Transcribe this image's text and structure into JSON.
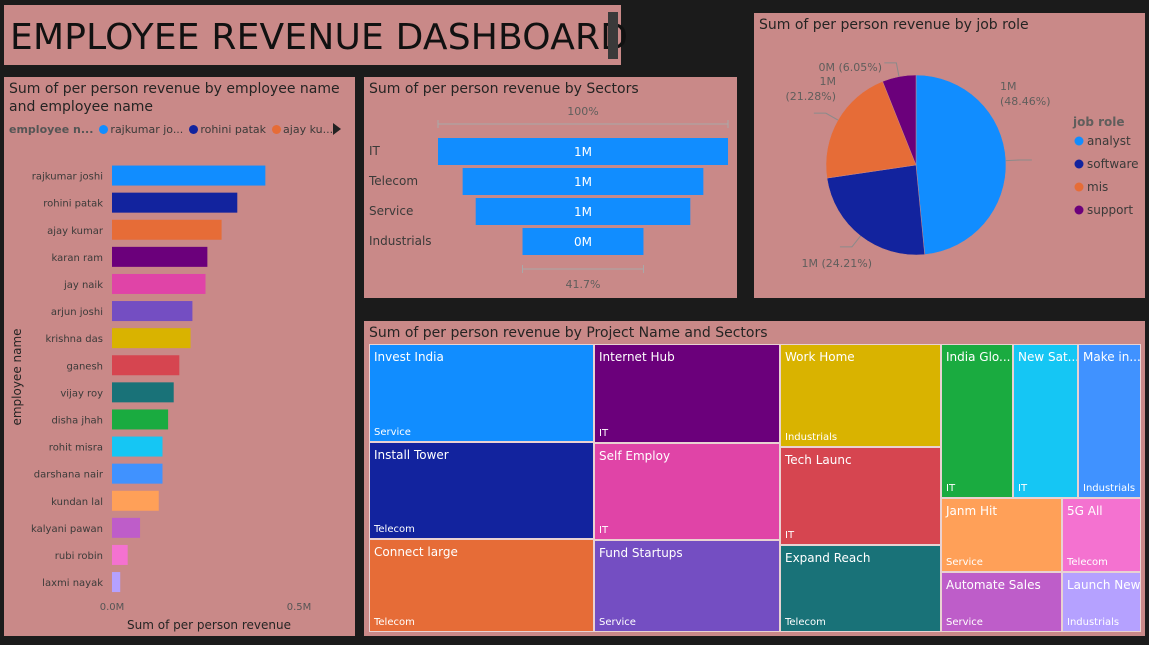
{
  "dashboard_title": "EMPLOYEE REVENUE DASHBOARD",
  "chart_data": [
    {
      "type": "bar",
      "orientation": "horizontal",
      "title": "Sum of per person revenue by employee name and employee name",
      "xlabel": "Sum of per person revenue",
      "ylabel": "employee name",
      "xlim": [
        0,
        0.5
      ],
      "x_ticks": [
        "0.0M",
        "0.5M"
      ],
      "legend": {
        "title": "employee n...",
        "entries": [
          "rajkumar jo...",
          "rohini patak",
          "ajay ku..."
        ]
      },
      "categories": [
        "rajkumar joshi",
        "rohini patak",
        "ajay kumar",
        "karan ram",
        "jay naik",
        "arjun joshi",
        "krishna das",
        "ganesh",
        "vijay roy",
        "disha jhah",
        "rohit misra",
        "darshana nair",
        "kundan lal",
        "kalyani pawan",
        "rubi robin",
        "laxmi nayak"
      ],
      "values": [
        0.41,
        0.335,
        0.293,
        0.255,
        0.25,
        0.215,
        0.21,
        0.18,
        0.165,
        0.15,
        0.135,
        0.135,
        0.125,
        0.075,
        0.042,
        0.022
      ],
      "colors": [
        "#118dff",
        "#12239e",
        "#e66c37",
        "#6b007b",
        "#e044a7",
        "#744ec2",
        "#d9b300",
        "#d64550",
        "#197278",
        "#1aab40",
        "#15c6f4",
        "#4092ff",
        "#ffa058",
        "#be5dc9",
        "#f472d0",
        "#b5a1ff"
      ]
    },
    {
      "type": "bar",
      "subtype": "funnel",
      "title": "Sum of per person revenue by Sectors",
      "categories": [
        "IT",
        "Telecom",
        "Service",
        "Industrials"
      ],
      "values": [
        1.0,
        0.83,
        0.74,
        0.417
      ],
      "value_labels": [
        "1M",
        "1M",
        "1M",
        "0M"
      ],
      "top_label": "100%",
      "bottom_label": "41.7%",
      "color": "#118dff"
    },
    {
      "type": "pie",
      "title": "Sum of per person revenue by job role",
      "legend": {
        "title": "job role",
        "placement": "right"
      },
      "categories": [
        "analyst",
        "software",
        "mis",
        "support"
      ],
      "values": [
        48.46,
        24.21,
        21.28,
        6.05
      ],
      "value_labels": [
        "1M",
        "1M (24.21%)",
        "1M",
        "0M (6.05%)"
      ],
      "percent_labels": [
        "(48.46%)",
        "",
        "(21.28%)",
        ""
      ],
      "colors": [
        "#118dff",
        "#12239e",
        "#e66c37",
        "#6b007b"
      ]
    },
    {
      "type": "treemap",
      "title": "Sum of per person revenue by Project Name and Sectors",
      "items": [
        {
          "name": "Invest India",
          "sector": "Service",
          "color": "#118dff"
        },
        {
          "name": "Install Tower",
          "sector": "Telecom",
          "color": "#12239e"
        },
        {
          "name": "Connect large",
          "sector": "Telecom",
          "color": "#e66c37"
        },
        {
          "name": "Internet Hub",
          "sector": "IT",
          "color": "#6b007b"
        },
        {
          "name": "Self Employ",
          "sector": "IT",
          "color": "#e044a7"
        },
        {
          "name": "Fund Startups",
          "sector": "Service",
          "color": "#744ec2"
        },
        {
          "name": "Work Home",
          "sector": "Industrials",
          "color": "#d9b300"
        },
        {
          "name": "Tech Launc",
          "sector": "IT",
          "color": "#d64550"
        },
        {
          "name": "Expand Reach",
          "sector": "Telecom",
          "color": "#197278"
        },
        {
          "name": "India Glo...",
          "sector": "IT",
          "color": "#1aab40"
        },
        {
          "name": "New Sat...",
          "sector": "IT",
          "color": "#15c6f4"
        },
        {
          "name": "Make in...",
          "sector": "Industrials",
          "color": "#4092ff"
        },
        {
          "name": "Janm Hit",
          "sector": "Service",
          "color": "#ffa058"
        },
        {
          "name": "5G All",
          "sector": "Telecom",
          "color": "#f472d0"
        },
        {
          "name": "Automate Sales",
          "sector": "Service",
          "color": "#be5dc9"
        },
        {
          "name": "Launch New",
          "sector": "Industrials",
          "color": "#b5a1ff"
        }
      ]
    }
  ]
}
